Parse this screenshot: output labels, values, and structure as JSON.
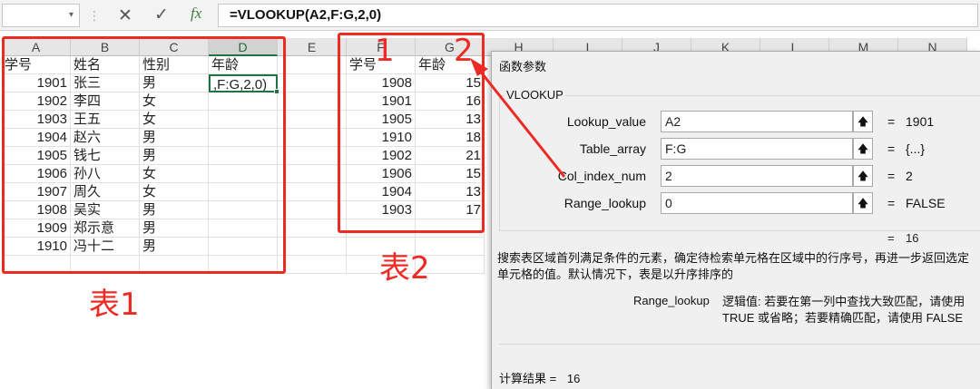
{
  "formula_bar": {
    "name_box": "",
    "name_box_arrow": "▾",
    "separator": "⋮",
    "cancel_icon": "✕",
    "enter_icon": "✓",
    "fx_label": "fx",
    "formula": "=VLOOKUP(A2,F:G,2,0)"
  },
  "columns": [
    "A",
    "B",
    "C",
    "D",
    "E",
    "F",
    "G",
    "H",
    "I",
    "J",
    "K",
    "L",
    "M",
    "N"
  ],
  "table1": {
    "headers": [
      "学号",
      "姓名",
      "性别",
      "年龄"
    ],
    "rows": [
      [
        "1901",
        "张三",
        "男"
      ],
      [
        "1902",
        "李四",
        "女"
      ],
      [
        "1903",
        "王五",
        "女"
      ],
      [
        "1904",
        "赵六",
        "男"
      ],
      [
        "1905",
        "钱七",
        "男"
      ],
      [
        "1906",
        "孙八",
        "女"
      ],
      [
        "1907",
        "周久",
        "女"
      ],
      [
        "1908",
        "吴实",
        "男"
      ],
      [
        "1909",
        "郑示意",
        "男"
      ],
      [
        "1910",
        "冯十二",
        "男"
      ]
    ],
    "editing_cell": ",F:G,2,0)"
  },
  "table2": {
    "headers": [
      "学号",
      "年龄"
    ],
    "rows": [
      [
        "1908",
        "15"
      ],
      [
        "1901",
        "16"
      ],
      [
        "1905",
        "13"
      ],
      [
        "1910",
        "18"
      ],
      [
        "1902",
        "21"
      ],
      [
        "1906",
        "15"
      ],
      [
        "1904",
        "13"
      ],
      [
        "1903",
        "17"
      ]
    ]
  },
  "annotations": {
    "label1": "表1",
    "label2": "表2",
    "num1": "1",
    "num2": "2",
    "color": "#ee2a24"
  },
  "dialog": {
    "title": "函数参数",
    "function_name": "VLOOKUP",
    "args": [
      {
        "label": "Lookup_value",
        "value": "A2",
        "result": "1901"
      },
      {
        "label": "Table_array",
        "value": "F:G",
        "result": "{...}"
      },
      {
        "label": "Col_index_num",
        "value": "2",
        "result": "2"
      },
      {
        "label": "Range_lookup",
        "value": "0",
        "result": "FALSE"
      }
    ],
    "equals": "=",
    "collapse_icon": "🡅",
    "result": "16",
    "description": "搜索表区域首列满足条件的元素，确定待检索单元格在区域中的行序号，再进一步返回选定单元格的值。默认情况下，表是以升序排序的",
    "range_lookup_name": "Range_lookup",
    "range_lookup_desc": "逻辑值: 若要在第一列中查找大致匹配，请使用 TRUE 或省略；若要精确匹配，请使用 FALSE",
    "calc_label": "计算结果 =",
    "calc_value": "16"
  }
}
